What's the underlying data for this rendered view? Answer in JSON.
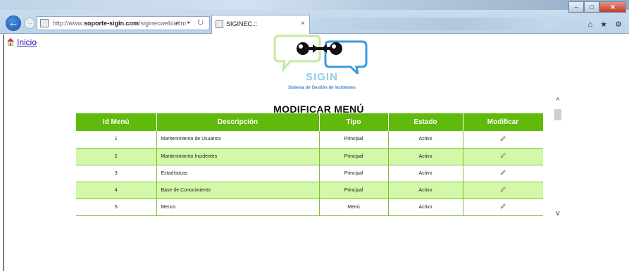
{
  "browser": {
    "url_prefix": "http://www.",
    "url_domain": "soporte-sigin.com",
    "url_path": "/siginecweb/adm",
    "url_tools": "⌕ ▾ ↻",
    "tab_title": "SIGINEC.::",
    "tab_close": "×",
    "back_label": "←",
    "forward_label": "→",
    "window_min": "–",
    "window_max": "□",
    "window_close": "✕",
    "tool_icons": "⌂ ★ ⚙"
  },
  "page": {
    "home_link": "Inicio",
    "logo_name": "SIGIN",
    "logo_subtitle": "Sistema de Gestión de Incidentes",
    "title": "MODIFICAR MENÚ"
  },
  "table": {
    "headers": [
      "Id Menú",
      "Descripción",
      "Tipo",
      "Estado",
      "Modificar"
    ],
    "rows": [
      {
        "id": "1",
        "descripcion": "Mantenimiento de Usuarios",
        "tipo": "Principal",
        "estado": "Activo"
      },
      {
        "id": "2",
        "descripcion": "Mantenimiento Incidentes",
        "tipo": "Principal",
        "estado": "Activo"
      },
      {
        "id": "3",
        "descripcion": "Estadísticas",
        "tipo": "Principal",
        "estado": "Activo"
      },
      {
        "id": "4",
        "descripcion": "Base de Conocimiento",
        "tipo": "Principal",
        "estado": "Activo"
      },
      {
        "id": "5",
        "descripcion": "Menus",
        "tipo": "Menú",
        "estado": "Activo"
      }
    ]
  },
  "scrollbar": {
    "up": "^",
    "down": "v"
  },
  "colors": {
    "header_green": "#5fba0a",
    "row_alt": "#d2f8a8",
    "logo_green": "#c5e8a0",
    "logo_blue": "#3b9be0"
  },
  "icons": [
    "back-arrow-icon",
    "forward-arrow-icon",
    "home-icon",
    "pencil-icon",
    "favicon-icon"
  ]
}
